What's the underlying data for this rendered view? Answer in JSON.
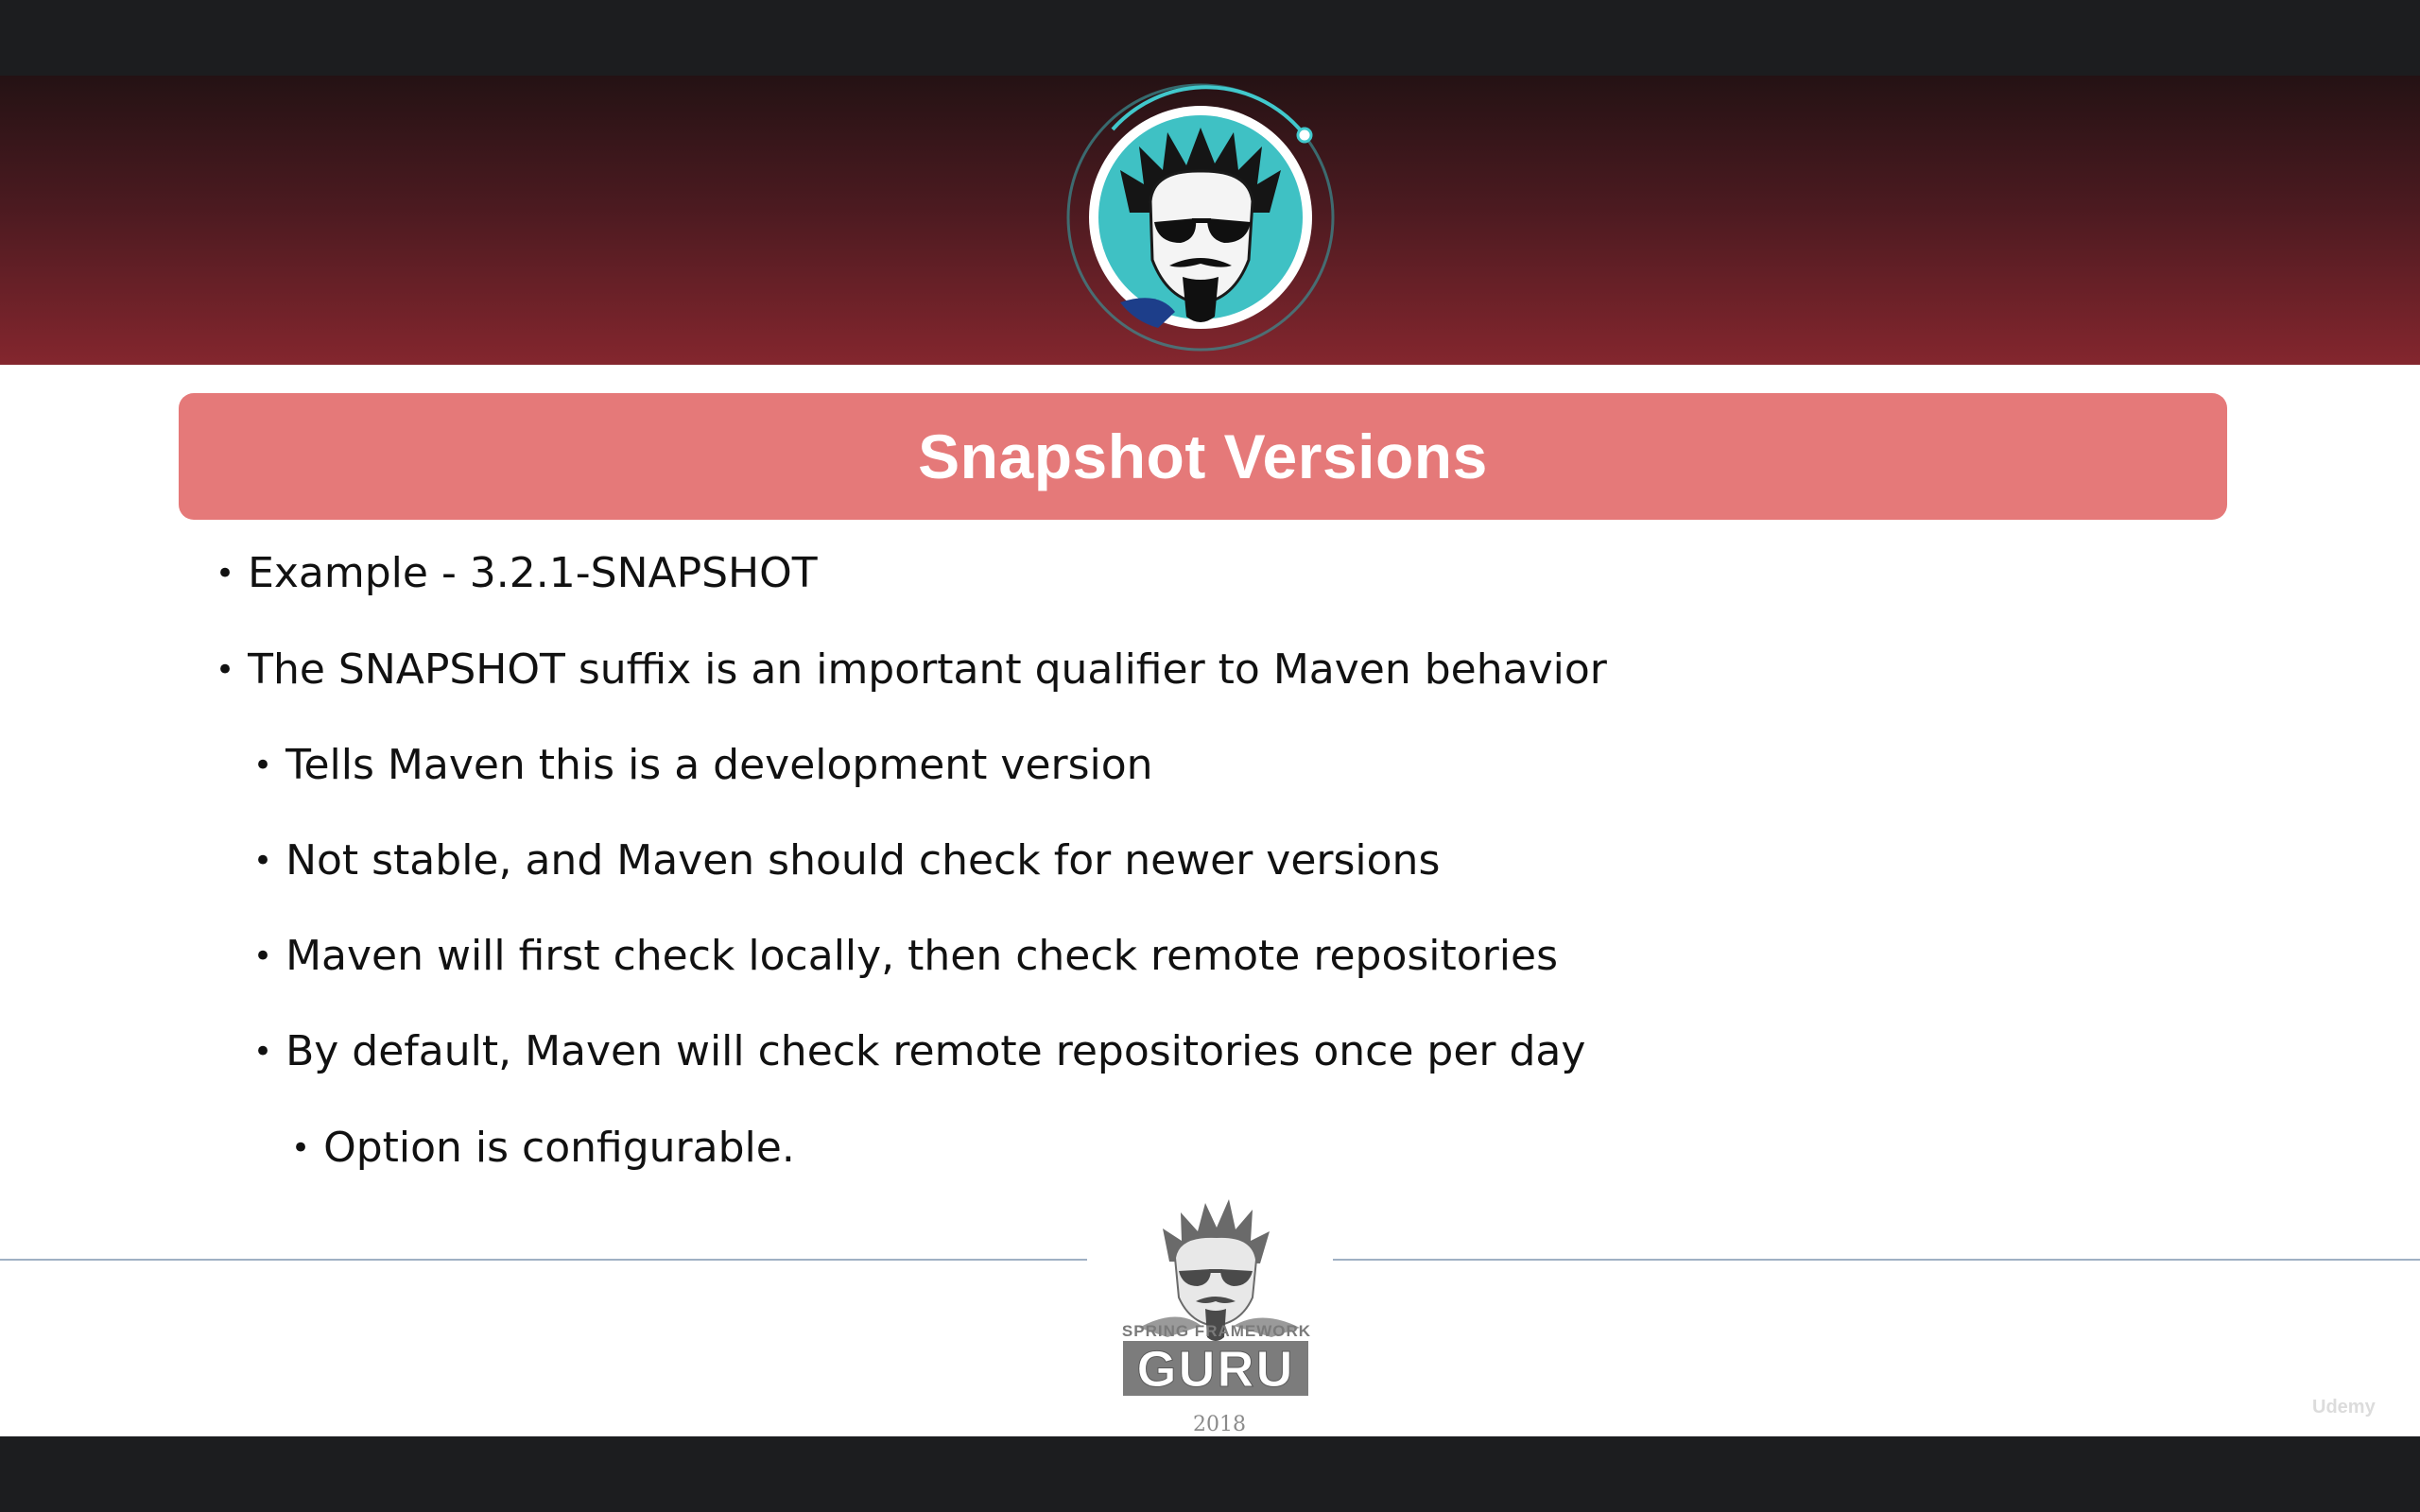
{
  "slide": {
    "title": "Snapshot Versions",
    "bullets": [
      {
        "level": 1,
        "text": "Example - 3.2.1-SNAPSHOT"
      },
      {
        "level": 1,
        "text": "The SNAPSHOT suffix is an important qualifier to Maven behavior"
      },
      {
        "level": 2,
        "text": "Tells Maven this is a development version"
      },
      {
        "level": 2,
        "text": "Not stable, and Maven should check for newer versions"
      },
      {
        "level": 2,
        "text": "Maven will first check locally, then check remote repositories"
      },
      {
        "level": 2,
        "text": "By default, Maven will check remote repositories once per day"
      },
      {
        "level": 3,
        "text": "Option is configurable."
      }
    ],
    "bullet_glyph": "•"
  },
  "footer": {
    "logo_line1": "SPRING FRAMEWORK",
    "logo_line2": "GURU",
    "year": "2018"
  },
  "watermark": {
    "brand": "Udemy"
  },
  "colors": {
    "title_bar": "#e57979",
    "header_top": "#241214",
    "header_bottom": "#84262e",
    "letterbox": "#1c1d1f",
    "avatar_ring": "#3fc1c4",
    "rule": "#9fb0c3"
  },
  "icons": {
    "header_avatar": "guru-avatar-icon",
    "footer_logo": "spring-framework-guru-logo"
  }
}
